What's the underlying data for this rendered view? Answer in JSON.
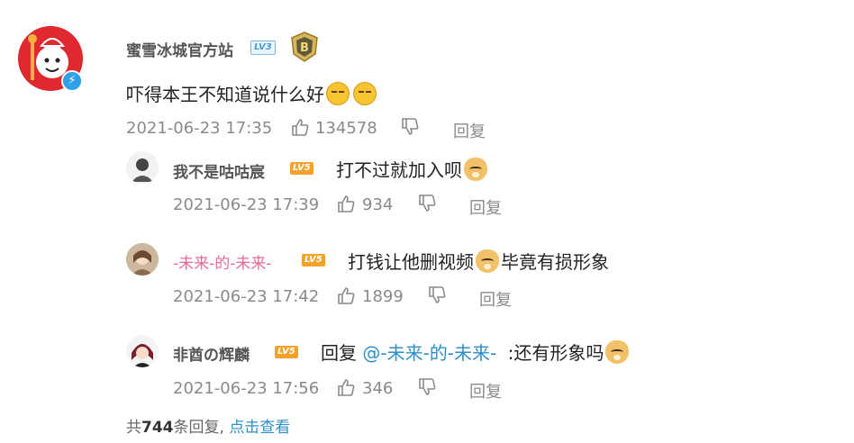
{
  "main_comment": {
    "user": "蜜雪冰城官方站",
    "level": "LV3",
    "text": "吓得本王不知道说什么好",
    "time": "2021-06-23 17:35",
    "likes": "134578",
    "reply_label": "回复"
  },
  "replies": [
    {
      "user": "我不是咕咕宸",
      "level": "LV5",
      "text": "打不过就加入呗",
      "time": "2021-06-23 17:39",
      "likes": "934",
      "reply_label": "回复"
    },
    {
      "user": "-未来-的-未来-",
      "level": "LV5",
      "text_a": "打钱让他删视频",
      "text_b": "毕竟有损形象",
      "time": "2021-06-23 17:42",
      "likes": "1899",
      "reply_label": "回复"
    },
    {
      "user": "非酋の辉麟",
      "level": "LV5",
      "prefix": "回复",
      "mention": "@-未来-的-未来-",
      "text": ":还有形象吗",
      "time": "2021-06-23 17:56",
      "likes": "346",
      "reply_label": "回复"
    }
  ],
  "footer": {
    "prefix": "共",
    "count": "744",
    "suffix": "条回复,",
    "link": "点击查看"
  },
  "colors": {
    "accent_blue": "#2e8fc7",
    "pink_name": "#e86a93",
    "level_orange": "#f5a12a",
    "meta_gray": "#8a8a8a"
  }
}
